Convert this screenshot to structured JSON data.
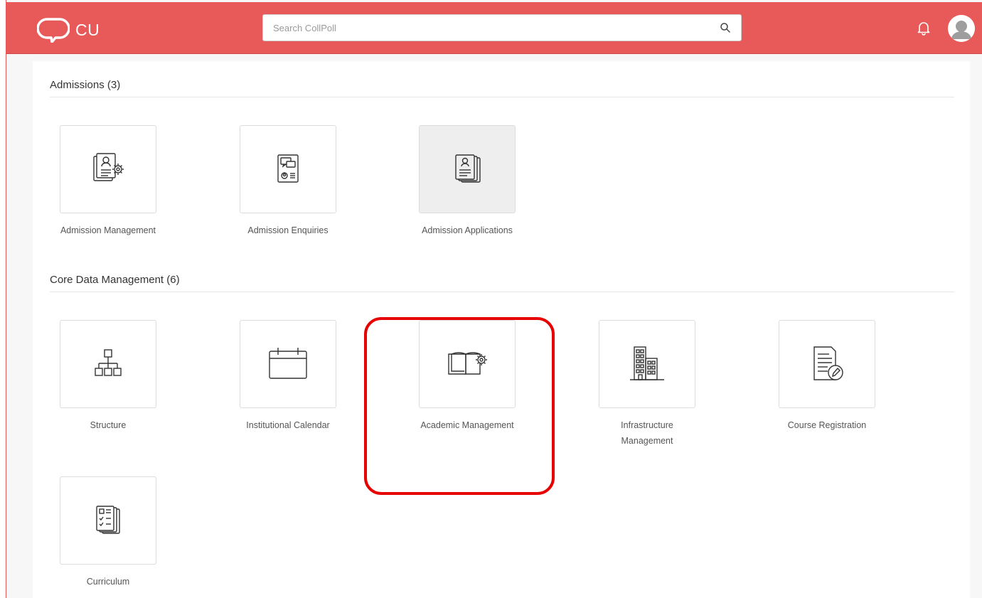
{
  "app": {
    "logo_text": "CU"
  },
  "search": {
    "placeholder": "Search CollPoll"
  },
  "sections": [
    {
      "title": "Admissions (3)",
      "tiles": [
        {
          "label": "Admission Management",
          "icon": "admission-management-icon"
        },
        {
          "label": "Admission Enquiries",
          "icon": "admission-enquiries-icon"
        },
        {
          "label": "Admission Applications",
          "icon": "admission-applications-icon",
          "selected": true
        }
      ]
    },
    {
      "title": "Core Data Management (6)",
      "tiles": [
        {
          "label": "Structure",
          "icon": "structure-icon"
        },
        {
          "label": "Institutional Calendar",
          "icon": "calendar-icon"
        },
        {
          "label": "Academic Management",
          "icon": "academic-management-icon",
          "highlighted": true
        },
        {
          "label": "Infrastructure Management",
          "icon": "building-icon"
        },
        {
          "label": "Course Registration",
          "icon": "course-registration-icon"
        },
        {
          "label": "Curriculum",
          "icon": "curriculum-icon"
        }
      ]
    }
  ],
  "colors": {
    "header": "#e85a5a",
    "highlight": "#e60000",
    "text": "#555555"
  }
}
